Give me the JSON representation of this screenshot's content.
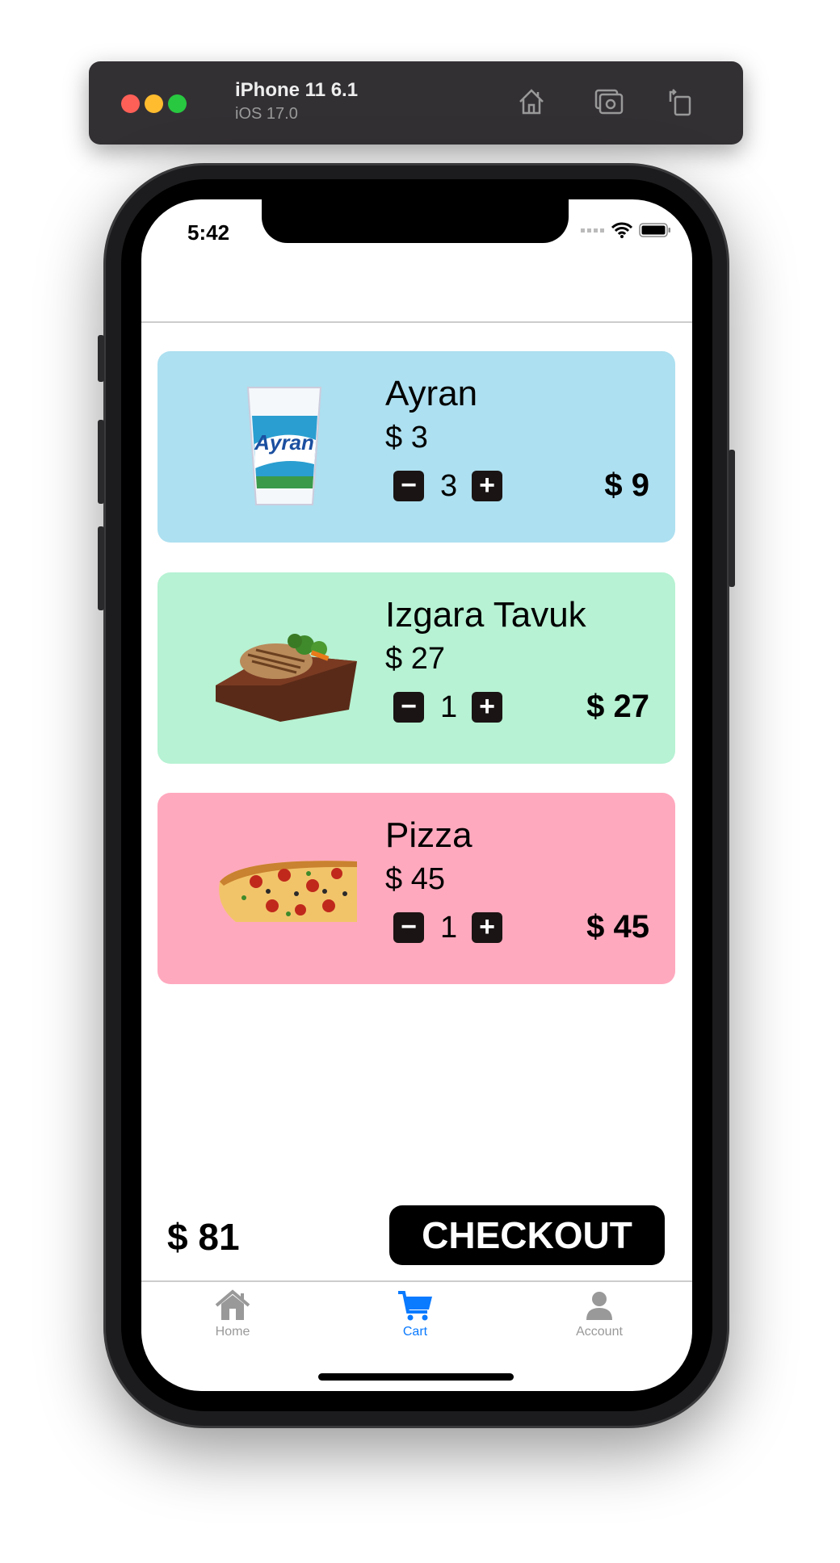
{
  "simulator": {
    "device": "iPhone 11 6.1",
    "os": "iOS 17.0"
  },
  "status_bar": {
    "time": "5:42"
  },
  "cart": {
    "items": [
      {
        "name": "Ayran",
        "price": "$ 3",
        "quantity": "3",
        "total": "$ 9",
        "color": "#ADE0F0",
        "image": "ayran-cup"
      },
      {
        "name": "Izgara Tavuk",
        "price": "$ 27",
        "quantity": "1",
        "total": "$ 27",
        "color": "#B6F2D3",
        "image": "grilled-chicken"
      },
      {
        "name": "Pizza",
        "price": "$ 45",
        "quantity": "1",
        "total": "$ 45",
        "color": "#FFA9BE",
        "image": "pizza"
      }
    ],
    "minus": "−",
    "plus": "+",
    "grand_total": "$ 81",
    "checkout_label": "CHECKOUT"
  },
  "tabs": [
    {
      "label": "Home",
      "icon": "house-icon",
      "active": false
    },
    {
      "label": "Cart",
      "icon": "cart-icon",
      "active": true
    },
    {
      "label": "Account",
      "icon": "person-icon",
      "active": false
    }
  ],
  "colors": {
    "active_tab": "#0A7AFF",
    "inactive_tab": "#999999"
  }
}
